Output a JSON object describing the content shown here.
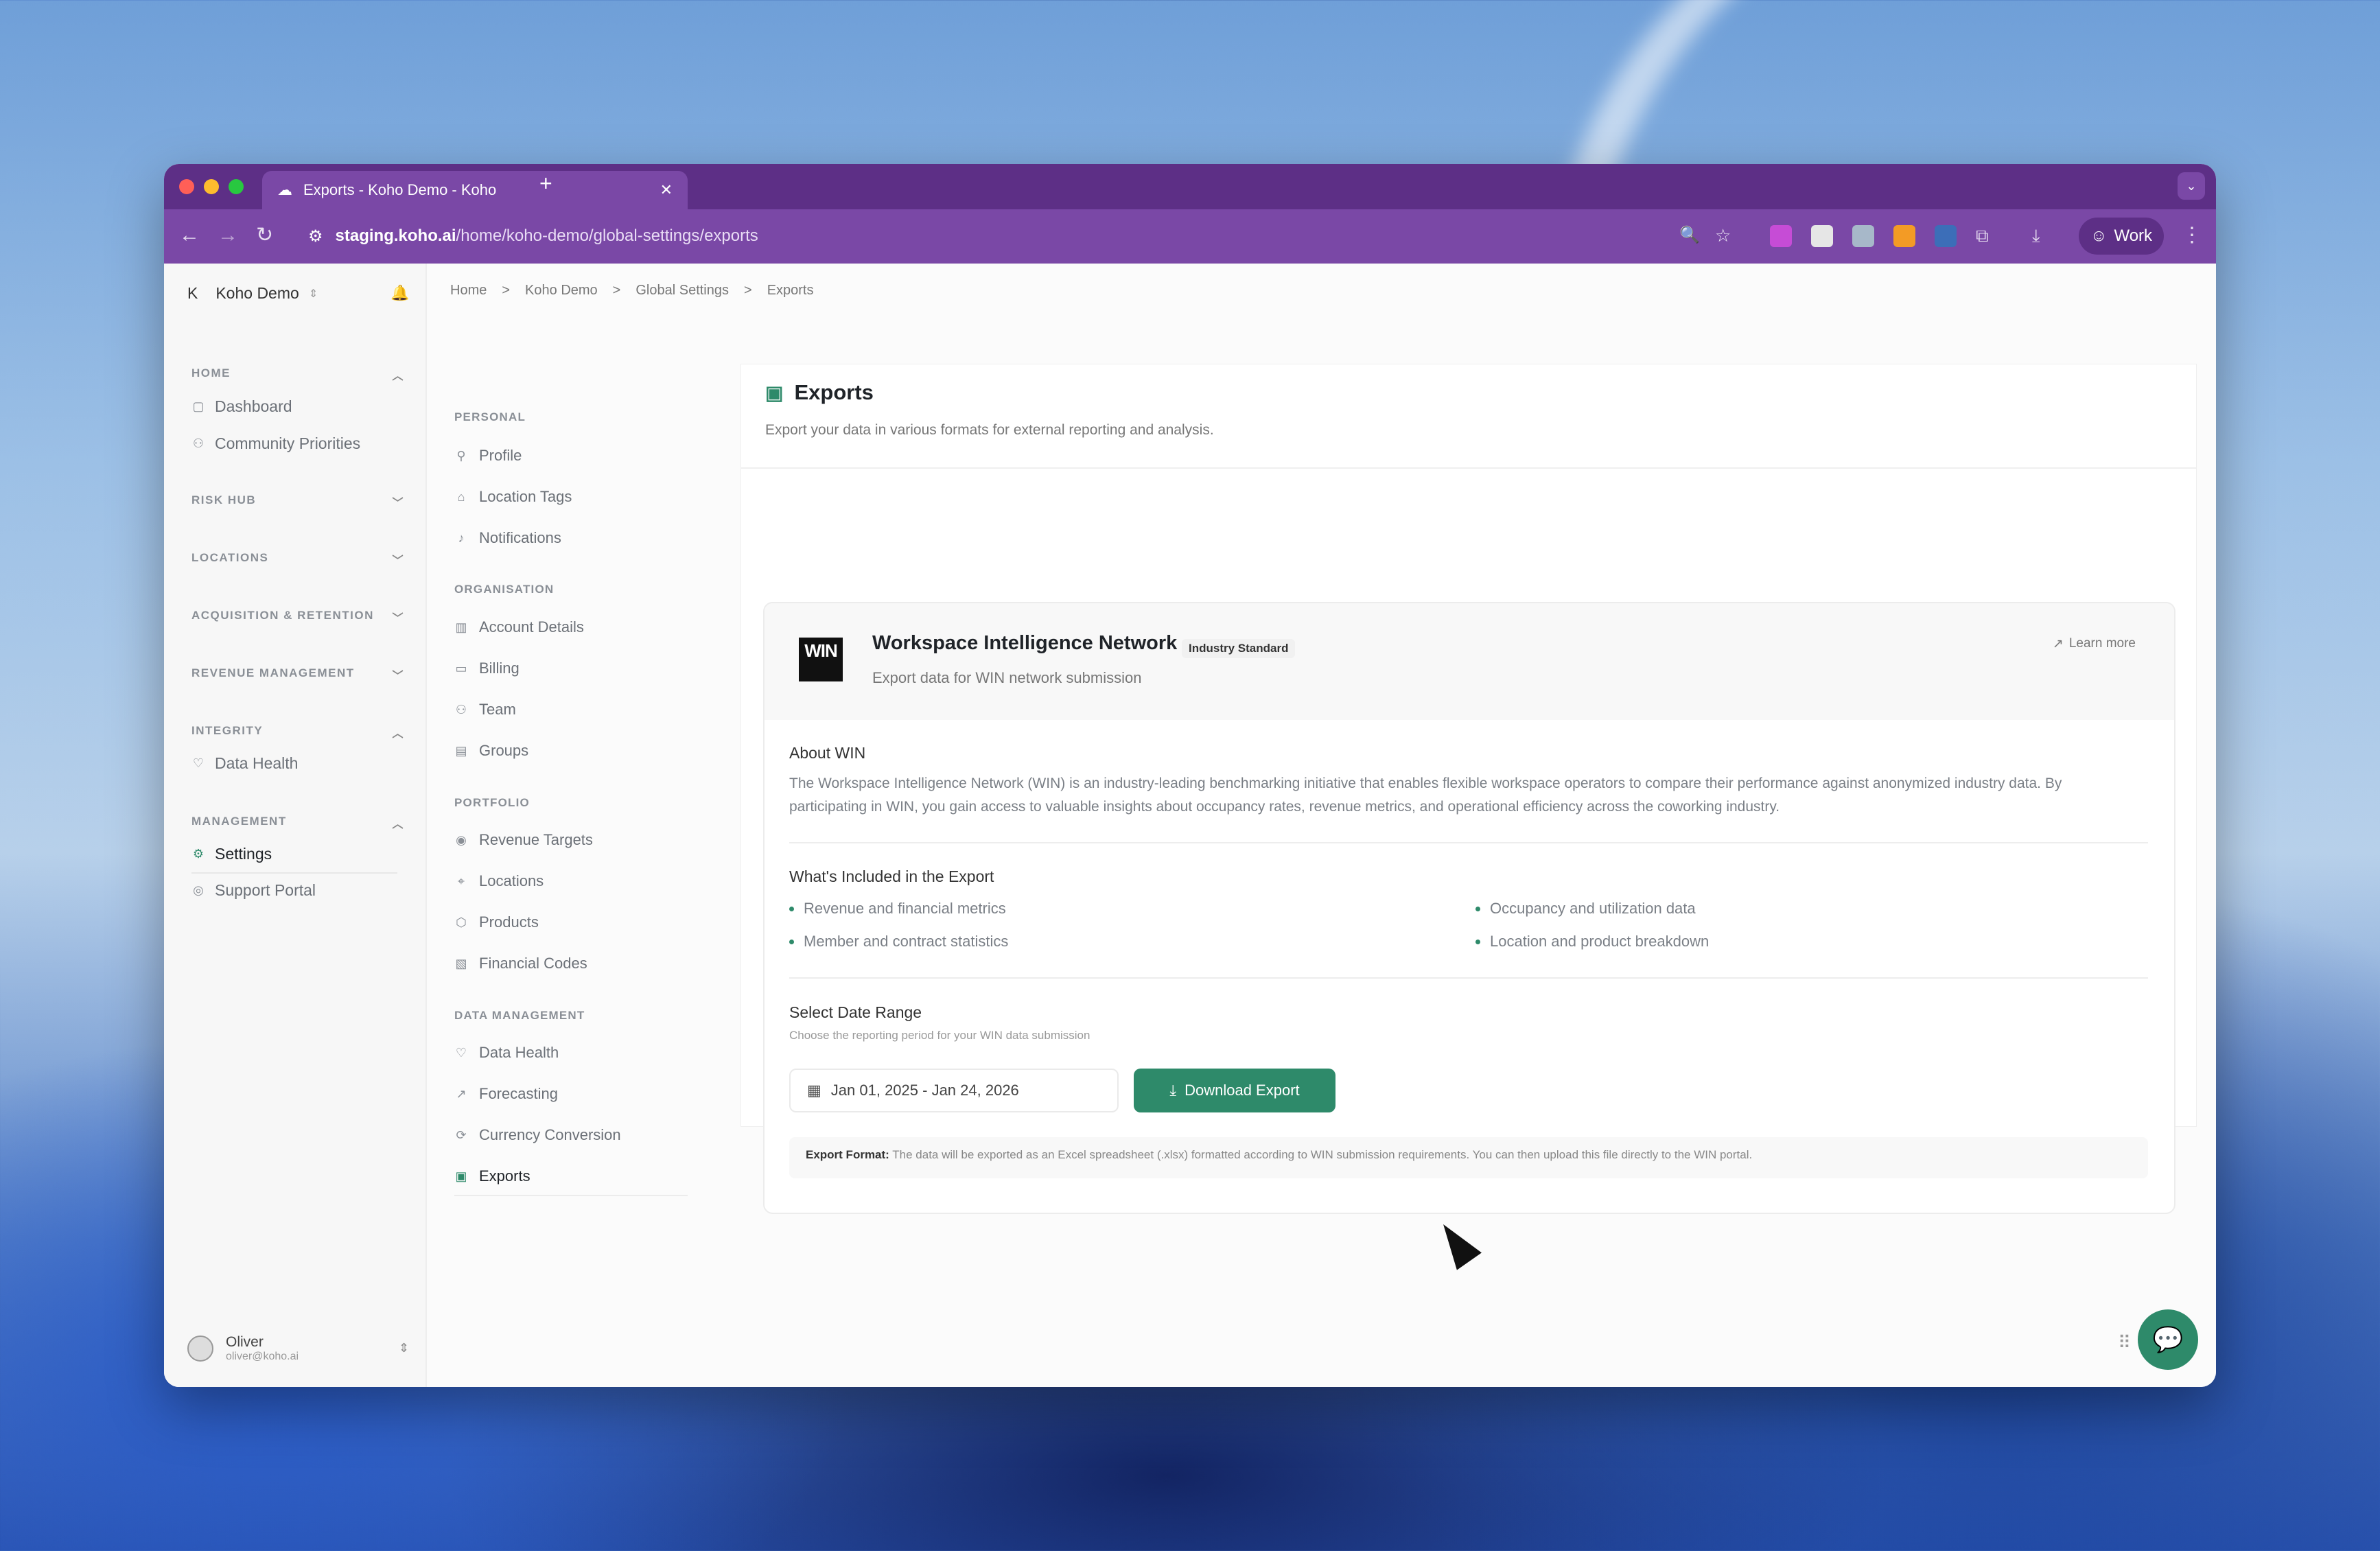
{
  "browser": {
    "tab_title": "Exports - Koho Demo - Koho",
    "url_domain": "staging.koho.ai",
    "url_path": "/home/koho-demo/global-settings/exports",
    "profile": "Work"
  },
  "sidebar": {
    "org_initial": "K",
    "org_name": "Koho Demo",
    "sections": {
      "home": "HOME",
      "risk_hub": "RISK HUB",
      "locations": "LOCATIONS",
      "acquisition": "ACQUISITION & RETENTION",
      "revenue": "REVENUE MANAGEMENT",
      "integrity": "INTEGRITY",
      "management": "MANAGEMENT"
    },
    "items": {
      "dashboard": "Dashboard",
      "community": "Community Priorities",
      "data_health": "Data Health",
      "settings": "Settings",
      "support": "Support Portal"
    },
    "user": {
      "name": "Oliver",
      "email": "oliver@koho.ai"
    }
  },
  "breadcrumb": [
    "Home",
    "Koho Demo",
    "Global Settings",
    "Exports"
  ],
  "settings_nav": {
    "groups": {
      "personal": "PERSONAL",
      "organisation": "ORGANISATION",
      "portfolio": "PORTFOLIO",
      "data_management": "DATA MANAGEMENT"
    },
    "items": {
      "profile": "Profile",
      "location_tags": "Location Tags",
      "notifications": "Notifications",
      "account_details": "Account Details",
      "billing": "Billing",
      "team": "Team",
      "groups": "Groups",
      "revenue_targets": "Revenue Targets",
      "locations": "Locations",
      "products": "Products",
      "financial_codes": "Financial Codes",
      "data_health": "Data Health",
      "forecasting": "Forecasting",
      "currency_conversion": "Currency Conversion",
      "exports": "Exports"
    }
  },
  "page": {
    "title": "Exports",
    "description": "Export your data in various formats for external reporting and analysis."
  },
  "win_card": {
    "logo_text": "WIN",
    "title": "Workspace Intelligence Network",
    "badge": "Industry Standard",
    "subtitle": "Export data for WIN network submission",
    "learn_more": "Learn more",
    "about_label": "About WIN",
    "about_text": "The Workspace Intelligence Network (WIN) is an industry-leading benchmarking initiative that enables flexible workspace operators to compare their performance against anonymized industry data. By participating in WIN, you gain access to valuable insights about occupancy rates, revenue metrics, and operational efficiency across the coworking industry.",
    "included_label": "What's Included in the Export",
    "included": [
      "Revenue and financial metrics",
      "Occupancy and utilization data",
      "Member and contract statistics",
      "Location and product breakdown"
    ],
    "date_label": "Select Date Range",
    "date_hint": "Choose the reporting period for your WIN data submission",
    "date_value": "Jan 01, 2025 - Jan 24, 2026",
    "download_label": "Download Export",
    "format_label": "Export Format:",
    "format_text": "The data will be exported as an Excel spreadsheet (.xlsx) formatted according to WIN submission requirements. You can then upload this file directly to the WIN portal."
  }
}
